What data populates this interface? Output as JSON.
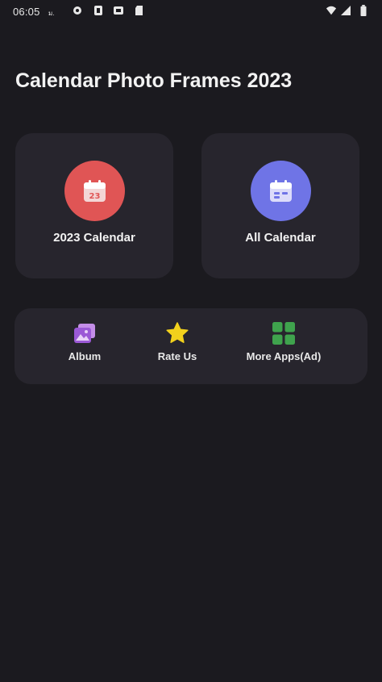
{
  "status_bar": {
    "time": "06:05",
    "time_suffix": "ม.",
    "icons": [
      "settings-icon",
      "b-app-icon",
      "notification-icon",
      "sim-icon",
      "wifi-icon",
      "signal-icon",
      "battery-icon"
    ]
  },
  "header": {
    "title": "Calendar Photo Frames 2023"
  },
  "cards": [
    {
      "label": "2023 Calendar",
      "icon": "calendar-icon",
      "badge": "23",
      "color": "#e05555"
    },
    {
      "label": "All Calendar",
      "icon": "calendar-icon",
      "color": "#6f74e6"
    }
  ],
  "actions": [
    {
      "label": "Album",
      "icon": "album-icon",
      "color": "#9b59d6"
    },
    {
      "label": "Rate Us",
      "icon": "star-icon",
      "color": "#f2d11c"
    },
    {
      "label": "More Apps(Ad)",
      "icon": "grid-icon",
      "color": "#3fa34d"
    }
  ],
  "colors": {
    "background": "#1b1a1f",
    "card": "#27252d"
  }
}
